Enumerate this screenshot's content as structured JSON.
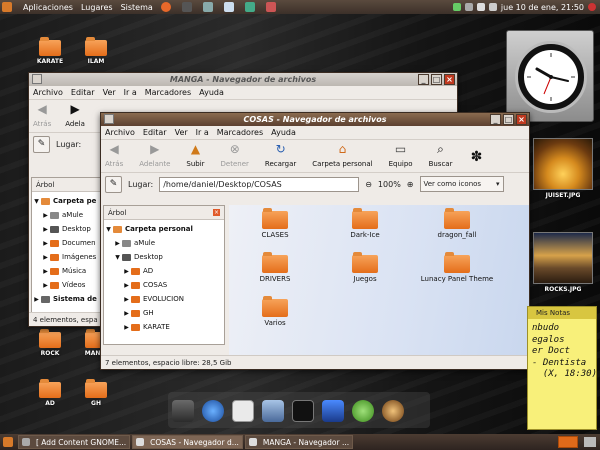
{
  "top_panel": {
    "menus": [
      "Aplicaciones",
      "Lugares",
      "Sistema"
    ],
    "clock": "jue 10 de ene, 21:50"
  },
  "desktop_icons": {
    "karate": "KARATE",
    "ilam": "ILAM",
    "rock": "ROCK",
    "mania": "MANIA",
    "ad": "AD",
    "gh": "GH",
    "sunset": "JUISET.JPG",
    "rocks": "ROCKS.JPG"
  },
  "manga_window": {
    "title": "MANGA - Navegador de archivos",
    "menu": [
      "Archivo",
      "Editar",
      "Ver",
      "Ir a",
      "Marcadores",
      "Ayuda"
    ],
    "toolbar": {
      "back": "Atrás",
      "forward": "Adela"
    },
    "location_label": "Lugar:",
    "sidebar_title": "Árbol",
    "tree": [
      "Carpeta pe",
      "aMule",
      "Desktop",
      "Documen",
      "Imágenes",
      "Música",
      "Vídeos",
      "Sistema de"
    ],
    "status": "4 elementos, espa"
  },
  "cosas_window": {
    "title": "COSAS - Navegador de archivos",
    "menu": [
      "Archivo",
      "Editar",
      "Ver",
      "Ir a",
      "Marcadores",
      "Ayuda"
    ],
    "toolbar": {
      "back": "Atrás",
      "forward": "Adelante",
      "up": "Subir",
      "stop": "Detener",
      "reload": "Recargar",
      "home": "Carpeta personal",
      "computer": "Equipo",
      "search": "Buscar"
    },
    "location_label": "Lugar:",
    "location": "/home/daniel/Desktop/COSAS",
    "zoom": "100%",
    "view_mode": "Ver como iconos",
    "sidebar_title": "Árbol",
    "tree": [
      {
        "label": "Carpeta personal",
        "bold": true,
        "indent": 0,
        "arrow": "▼"
      },
      {
        "label": "aMule",
        "indent": 1,
        "arrow": "▶"
      },
      {
        "label": "Desktop",
        "indent": 1,
        "arrow": "▼"
      },
      {
        "label": "AD",
        "indent": 2,
        "arrow": "▶"
      },
      {
        "label": "COSAS",
        "indent": 2,
        "arrow": "▶"
      },
      {
        "label": "EVOLUCION",
        "indent": 2,
        "arrow": "▶"
      },
      {
        "label": "GH",
        "indent": 2,
        "arrow": "▶"
      },
      {
        "label": "KARATE",
        "indent": 2,
        "arrow": "▶"
      }
    ],
    "files": [
      "CLASES",
      "Dark-Ice",
      "dragon_fall",
      "DRIVERS",
      "Juegos",
      "Lunacy Panel Theme",
      "Varios"
    ],
    "status": "7 elementos, espacio libre: 28,5 Gib"
  },
  "notes": {
    "title": "Mis Notas",
    "lines": [
      "nbudo",
      "egalos",
      "er Doct",
      "- Dentista",
      "  (X, 18:30)"
    ]
  },
  "taskbar": [
    {
      "label": "[ Add Content GNOME...",
      "active": false
    },
    {
      "label": "COSAS - Navegador d...",
      "active": true
    },
    {
      "label": "MANGA - Navegador ...",
      "active": false
    }
  ]
}
